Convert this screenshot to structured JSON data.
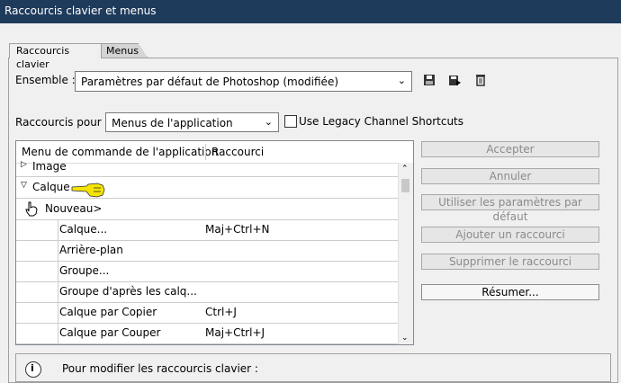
{
  "window": {
    "title": "Raccourcis clavier et menus"
  },
  "tabs": [
    {
      "label": "Raccourcis clavier"
    },
    {
      "label": "Menus"
    }
  ],
  "ensemble": {
    "label": "Ensemble :",
    "value": "Paramètres par défaut de Photoshop (modifiée)"
  },
  "toolbar_icons": [
    "save-icon",
    "save-as-icon",
    "delete-icon"
  ],
  "shortcuts_for": {
    "label": "Raccourcis pour :",
    "value": "Menus de l'application"
  },
  "legacy": {
    "label": "Use Legacy Channel Shortcuts",
    "checked": false
  },
  "table": {
    "col1": "Menu de commande de l'application",
    "col2": "Raccourci",
    "rows": [
      {
        "label": "Image",
        "shortcut": ""
      },
      {
        "label": "Calque",
        "shortcut": ""
      },
      {
        "label": "Nouveau>",
        "shortcut": ""
      },
      {
        "label": "Calque...",
        "shortcut": "Maj+Ctrl+N"
      },
      {
        "label": "Arrière-plan",
        "shortcut": ""
      },
      {
        "label": "Groupe...",
        "shortcut": ""
      },
      {
        "label": "Groupe d'après les calq...",
        "shortcut": ""
      },
      {
        "label": "Calque par Copier",
        "shortcut": "Ctrl+J"
      },
      {
        "label": "Calque par Couper",
        "shortcut": "Maj+Ctrl+J"
      }
    ]
  },
  "buttons": {
    "accept": "Accepter",
    "cancel": "Annuler",
    "use_defaults": "Utiliser les paramètres par défaut",
    "add": "Ajouter un raccourci",
    "delete": "Supprimer le raccourci",
    "summarize": "Résumer..."
  },
  "bottom": {
    "text": "Pour modifier les raccourcis clavier :"
  },
  "colors": {
    "titlebar": "#1f3b5c",
    "pointer_hand": "#f5e400"
  }
}
